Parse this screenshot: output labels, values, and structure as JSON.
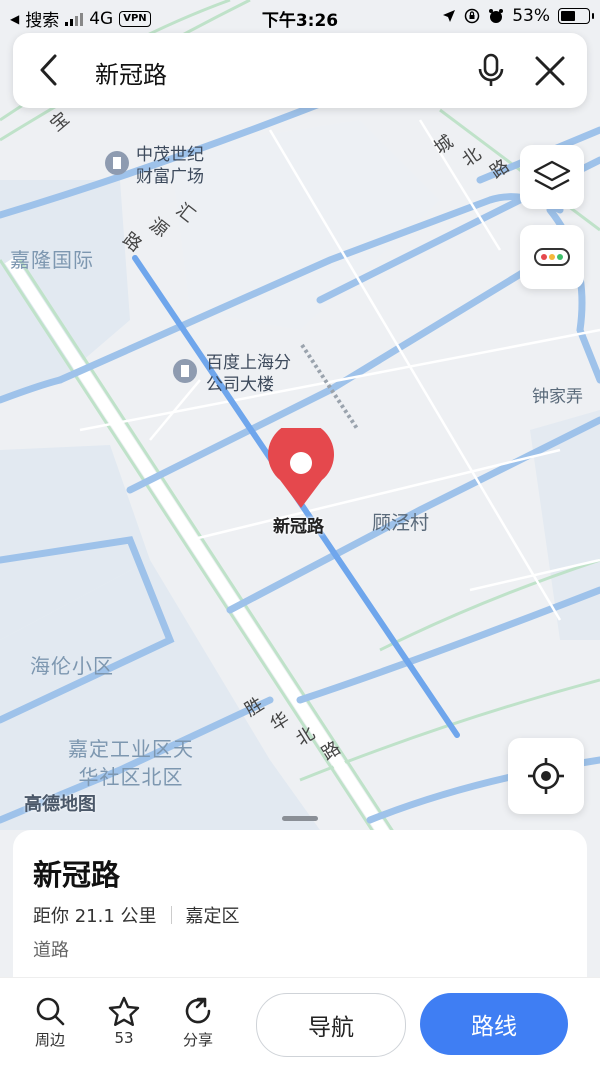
{
  "status_bar": {
    "back_app": "搜索",
    "network": "4G",
    "vpn": "VPN",
    "time": "下午3:26",
    "battery": "53%",
    "battery_level": 0.53
  },
  "search": {
    "query": "新冠路"
  },
  "map": {
    "poi_1": [
      "中茂世纪",
      "财富广场"
    ],
    "poi_2": [
      "百度上海分",
      "公司大楼"
    ],
    "area_jialong": "嘉隆国际",
    "area_hailun": "海伦小区",
    "area_industrial": [
      "嘉定工业区天",
      "华社区北区"
    ],
    "village_gujing": "顾泾村",
    "village_zhongjia": "钟家弄",
    "road_huiyuan": [
      "汇",
      "源",
      "路"
    ],
    "road_shenghua": [
      "胜",
      "华",
      "北",
      "路"
    ],
    "road_chengbei": [
      "城",
      "北",
      "路"
    ],
    "road_topleft": "宝",
    "pin_label": "新冠路",
    "watermark": "高德地图"
  },
  "card": {
    "title": "新冠路",
    "distance": "距你 21.1 公里",
    "district": "嘉定区",
    "type": "道路"
  },
  "bottom": {
    "nearby": "周边",
    "favorite_count": "53",
    "share": "分享",
    "navigate": "导航",
    "route": "路线"
  },
  "colors": {
    "accent": "#3f7ef3",
    "pin": "#e5484d",
    "water": "#9ec2ea",
    "highlight_road": "#6fa6ec"
  }
}
